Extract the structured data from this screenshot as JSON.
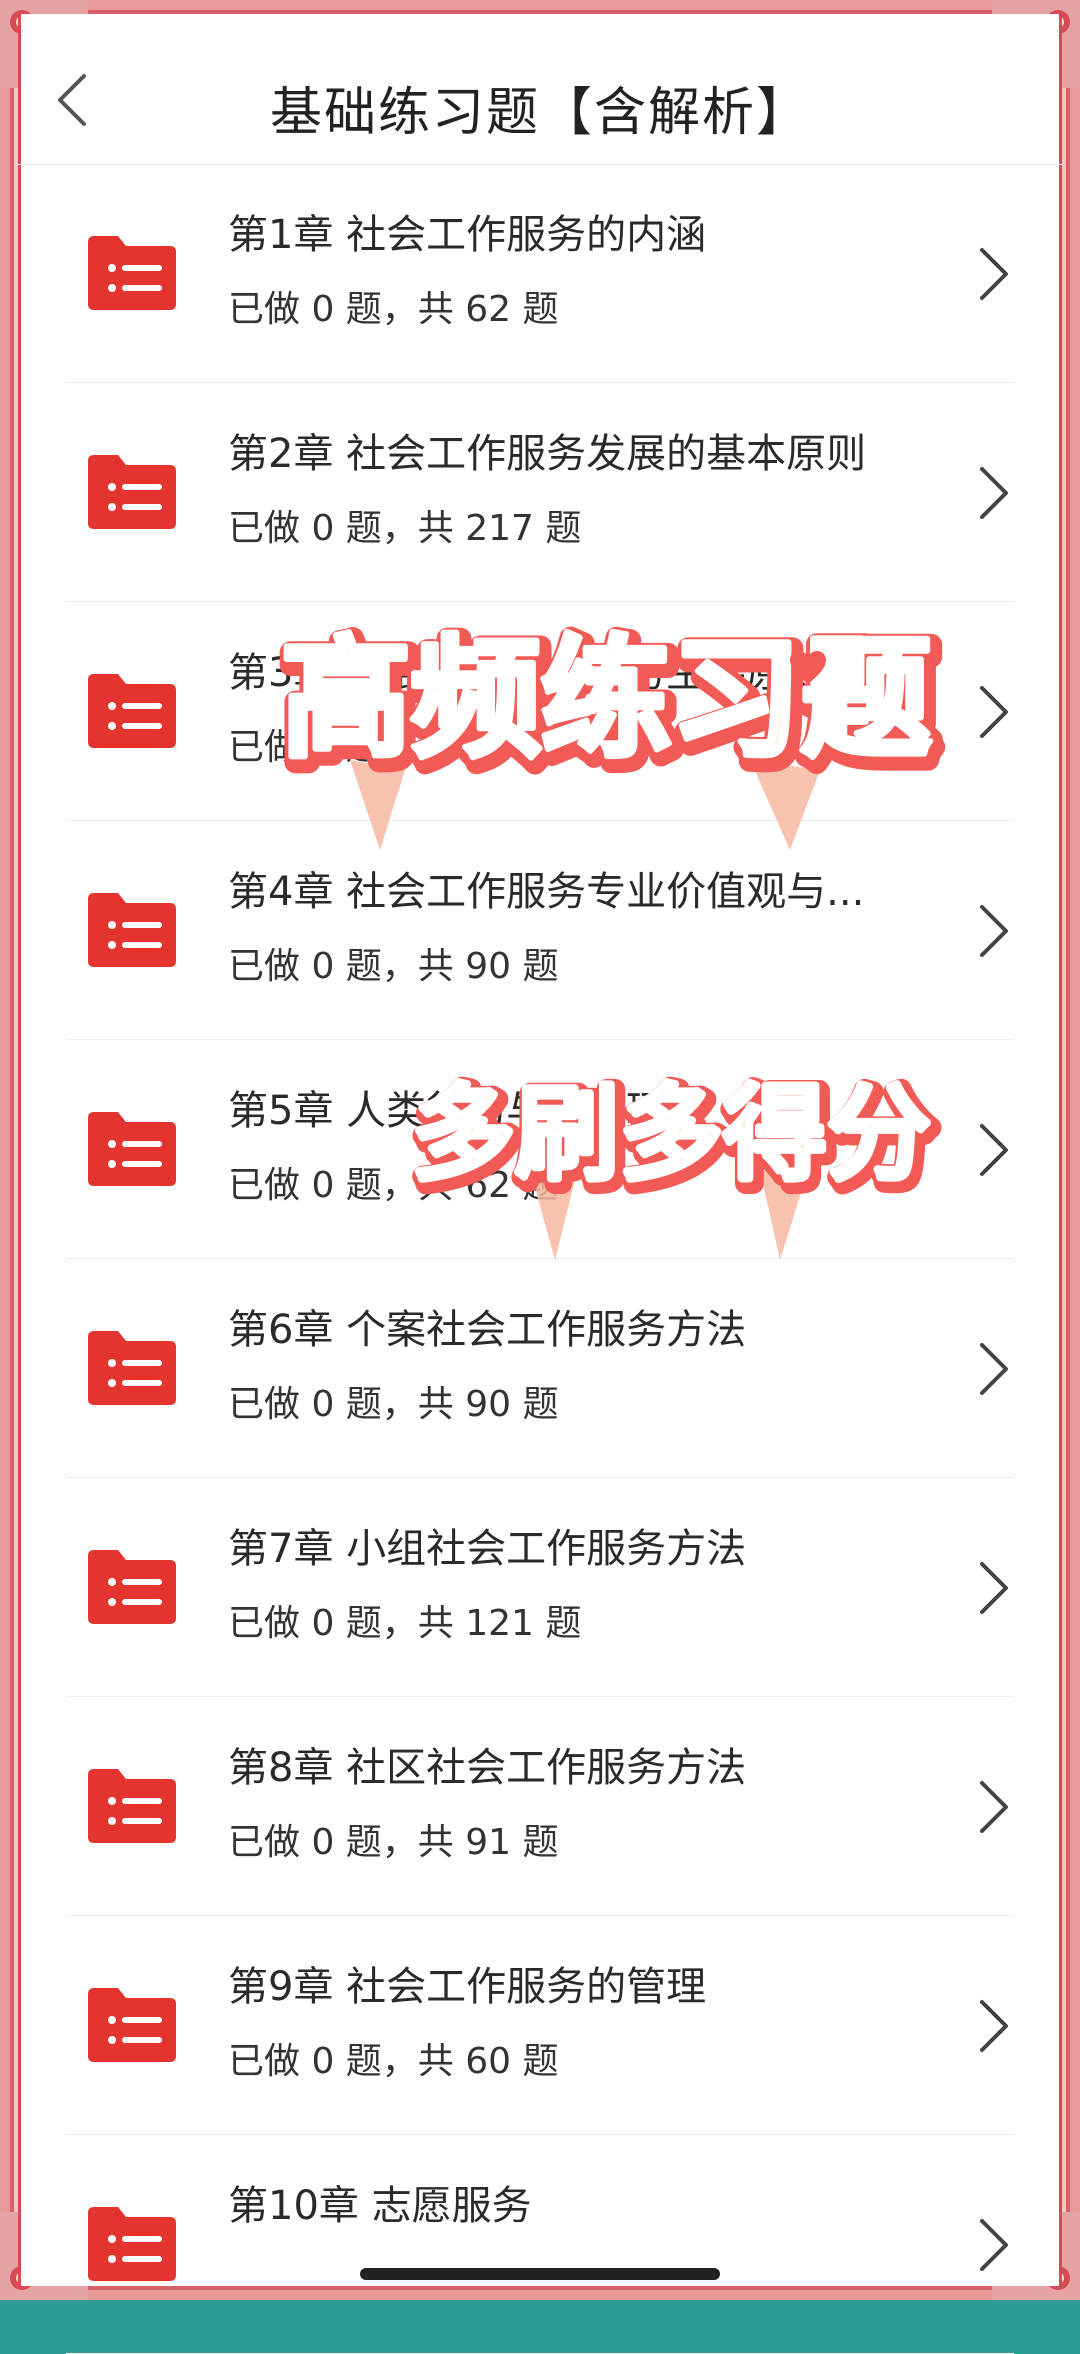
{
  "header": {
    "title": "基础练习题【含解析】"
  },
  "chapters": [
    {
      "title": "第1章 社会工作服务的内涵",
      "progress": "已做 0 题，共 62 题"
    },
    {
      "title": "第2章 社会工作服务发展的基本原则",
      "progress": "已做 0 题，共 217 题"
    },
    {
      "title": "第3章 开展社会工作服务主要原则",
      "progress": "已做 0 题，共 35 题"
    },
    {
      "title": "第4章 社会工作服务专业价值观与...",
      "progress": "已做 0 题，共 90 题"
    },
    {
      "title": "第5章 人类行为与社会环境",
      "progress": "已做 0 题，共 62 题"
    },
    {
      "title": "第6章 个案社会工作服务方法",
      "progress": "已做 0 题，共 90 题"
    },
    {
      "title": "第7章 小组社会工作服务方法",
      "progress": "已做 0 题，共 121 题"
    },
    {
      "title": "第8章 社区社会工作服务方法",
      "progress": "已做 0 题，共 91 题"
    },
    {
      "title": "第9章 社会工作服务的管理",
      "progress": "已做 0 题，共 60 题"
    },
    {
      "title": "第10章 志愿服务",
      "progress": ""
    }
  ],
  "overlay": {
    "banner_1": "高频练习题",
    "banner_2": "多刷多得分"
  },
  "colors": {
    "accent_red": "#e3342f",
    "frame_teal": "#2f9c93",
    "frame_pink": "#f6c7c3"
  },
  "icons": {
    "back": "back-chevron-icon",
    "folder": "list-folder-icon",
    "chevron": "chevron-right-icon"
  }
}
